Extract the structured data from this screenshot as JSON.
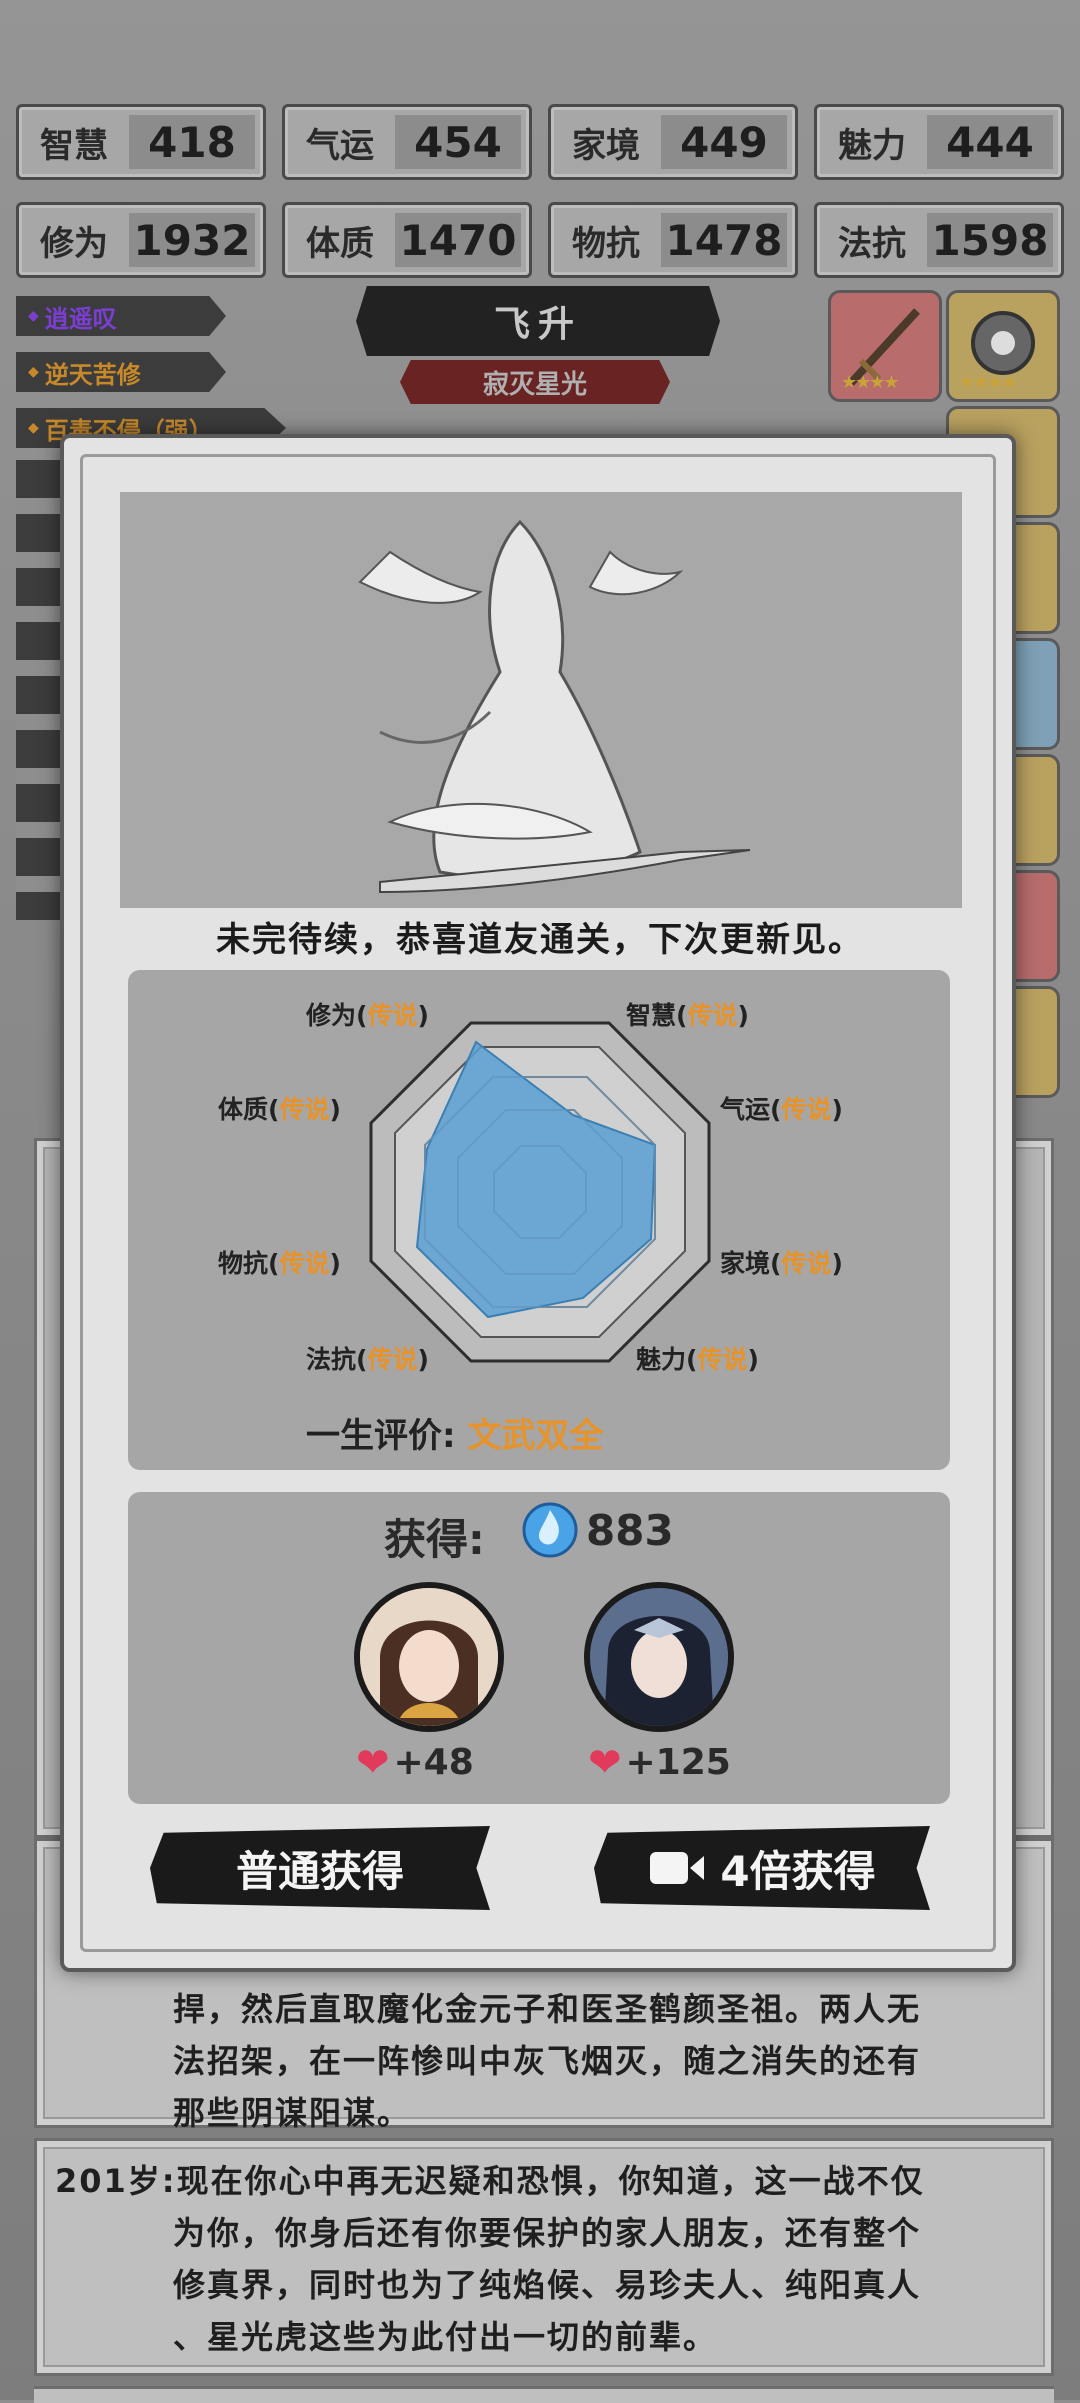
{
  "stats": [
    {
      "label": "智慧",
      "value": "418"
    },
    {
      "label": "气运",
      "value": "454"
    },
    {
      "label": "家境",
      "value": "449"
    },
    {
      "label": "魅力",
      "value": "444"
    },
    {
      "label": "修为",
      "value": "1932"
    },
    {
      "label": "体质",
      "value": "1470"
    },
    {
      "label": "物抗",
      "value": "1478"
    },
    {
      "label": "法抗",
      "value": "1598"
    }
  ],
  "tags": [
    {
      "label": "逍遥叹",
      "color": "#7a3fd0"
    },
    {
      "label": "逆天苦修",
      "color": "#c7892a"
    },
    {
      "label": "百毒不侵（强）",
      "color": "#c7892a"
    }
  ],
  "banner": {
    "title": "飞升",
    "subtitle": "寂灭星光"
  },
  "modal": {
    "headline": "未完待续，恭喜道友通关，下次更新见。",
    "radar": [
      {
        "stat": "修为",
        "grade": "传说"
      },
      {
        "stat": "智慧",
        "grade": "传说"
      },
      {
        "stat": "体质",
        "grade": "传说"
      },
      {
        "stat": "气运",
        "grade": "传说"
      },
      {
        "stat": "物抗",
        "grade": "传说"
      },
      {
        "stat": "家境",
        "grade": "传说"
      },
      {
        "stat": "法抗",
        "grade": "传说"
      },
      {
        "stat": "魅力",
        "grade": "传说"
      }
    ],
    "evaluation_label": "一生评价:",
    "evaluation_value": "文武双全",
    "reward_label": "获得:",
    "reward_amount": "883",
    "companions": [
      {
        "affection": "+48"
      },
      {
        "affection": "+125"
      }
    ],
    "btn_normal": "普通获得",
    "btn_4x": "4倍获得"
  },
  "story": {
    "card1_lines": [
      "捍，然后直取魔化金元子和医圣鹤颜圣祖。两人无",
      "法招架，在一阵惨叫中灰飞烟灭，随之消失的还有",
      "那些阴谋阳谋。"
    ],
    "card2_lines": [
      "201岁:现在你心中再无迟疑和恐惧，你知道，这一战不仅",
      "为你，你身后还有你要保护的家人朋友，还有整个",
      "修真界，同时也为了纯焰候、易珍夫人、纯阳真人",
      "、星光虎这些为此付出一切的前辈。"
    ]
  },
  "colors": {
    "legend": "#e5932a",
    "radar_fill": "#5b9fd3",
    "btn": "#1a1a1a"
  }
}
